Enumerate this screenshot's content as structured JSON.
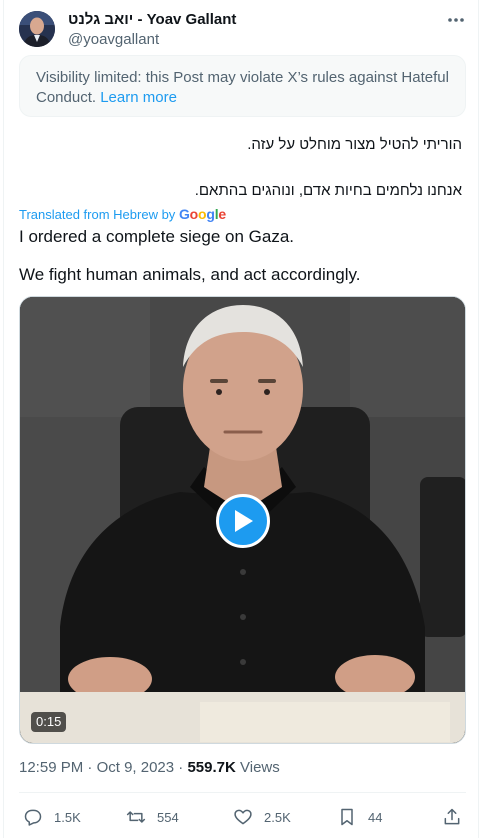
{
  "author": {
    "display_name": "יואב גלנט - Yoav Gallant",
    "handle": "@yoavgallant"
  },
  "notice": {
    "text": "Visibility limited: this Post may violate X’s rules against Hateful Conduct.",
    "link": "Learn more"
  },
  "post": {
    "original_lines": [
      "הוריתי להטיל מצור מוחלט על עזה.",
      "אנחנו נלחמים בחיות אדם, ונוהגים בהתאם."
    ],
    "translated_label": "Translated from Hebrew by",
    "translator": "Google",
    "translation_lines": [
      "I ordered a complete siege on Gaza.",
      "We fight human animals, and act accordingly."
    ]
  },
  "video": {
    "duration": "0:15"
  },
  "meta": {
    "time": "12:59 PM",
    "date": "Oct 9, 2023",
    "separator": "·",
    "views_count": "559.7K",
    "views_label": "Views"
  },
  "actions": {
    "replies": "1.5K",
    "reposts": "554",
    "likes": "2.5K",
    "bookmarks": "44"
  },
  "colors": {
    "accent": "#1d9bf0",
    "secondary_text": "#536471",
    "primary_text": "#0f1419"
  }
}
